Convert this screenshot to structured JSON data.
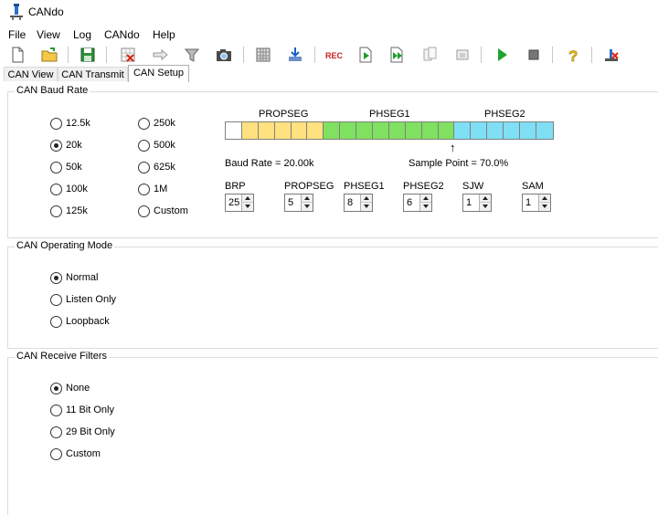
{
  "window": {
    "title": "CANdo"
  },
  "menu": [
    "File",
    "View",
    "Log",
    "CANdo",
    "Help"
  ],
  "toolbar": {
    "buttons": [
      "new-file-icon",
      "open-folder-icon",
      "save-icon",
      "clear-grid-icon",
      "forward-icon",
      "filter-icon",
      "camera-icon",
      "grid-icon",
      "download-icon",
      "record-icon",
      "play-document-icon",
      "play-document-double-icon",
      "copy-icon",
      "window-icon",
      "run-icon",
      "stop-icon",
      "help-icon",
      "disconnect-icon"
    ],
    "record_label": "REC"
  },
  "tabs": [
    {
      "label": "CAN View",
      "active": false
    },
    {
      "label": "CAN Transmit",
      "active": false
    },
    {
      "label": "CAN Setup",
      "active": true
    }
  ],
  "baud_rate": {
    "title": "CAN Baud Rate",
    "options": [
      {
        "label": "12.5k",
        "selected": false
      },
      {
        "label": "20k",
        "selected": true
      },
      {
        "label": "50k",
        "selected": false
      },
      {
        "label": "100k",
        "selected": false
      },
      {
        "label": "125k",
        "selected": false
      },
      {
        "label": "250k",
        "selected": false
      },
      {
        "label": "500k",
        "selected": false
      },
      {
        "label": "625k",
        "selected": false
      },
      {
        "label": "1M",
        "selected": false
      },
      {
        "label": "Custom",
        "selected": false
      }
    ],
    "segments": [
      {
        "name": "",
        "bits": 1,
        "color": "#ffffff"
      },
      {
        "name": "PROPSEG",
        "bits": 5,
        "color": "#ffe17f"
      },
      {
        "name": "PHSEG1",
        "bits": 8,
        "color": "#7fe15f"
      },
      {
        "name": "PHSEG2",
        "bits": 6,
        "color": "#7fdff5"
      }
    ],
    "baud_rate_text": "Baud Rate = 20.00k",
    "sample_point_text": "Sample Point = 70.0%",
    "sample_arrow": "↑",
    "params": [
      {
        "label": "BRP",
        "value": "25"
      },
      {
        "label": "PROPSEG",
        "value": "5"
      },
      {
        "label": "PHSEG1",
        "value": "8"
      },
      {
        "label": "PHSEG2",
        "value": "6"
      },
      {
        "label": "SJW",
        "value": "1"
      },
      {
        "label": "SAM",
        "value": "1"
      }
    ]
  },
  "operating_mode": {
    "title": "CAN Operating Mode",
    "options": [
      {
        "label": "Normal",
        "selected": true
      },
      {
        "label": "Listen Only",
        "selected": false
      },
      {
        "label": "Loopback",
        "selected": false
      }
    ]
  },
  "receive_filters": {
    "title": "CAN Receive Filters",
    "options": [
      {
        "label": "None",
        "selected": true
      },
      {
        "label": "11 Bit Only",
        "selected": false
      },
      {
        "label": "29 Bit Only",
        "selected": false
      },
      {
        "label": "Custom",
        "selected": false
      }
    ]
  }
}
